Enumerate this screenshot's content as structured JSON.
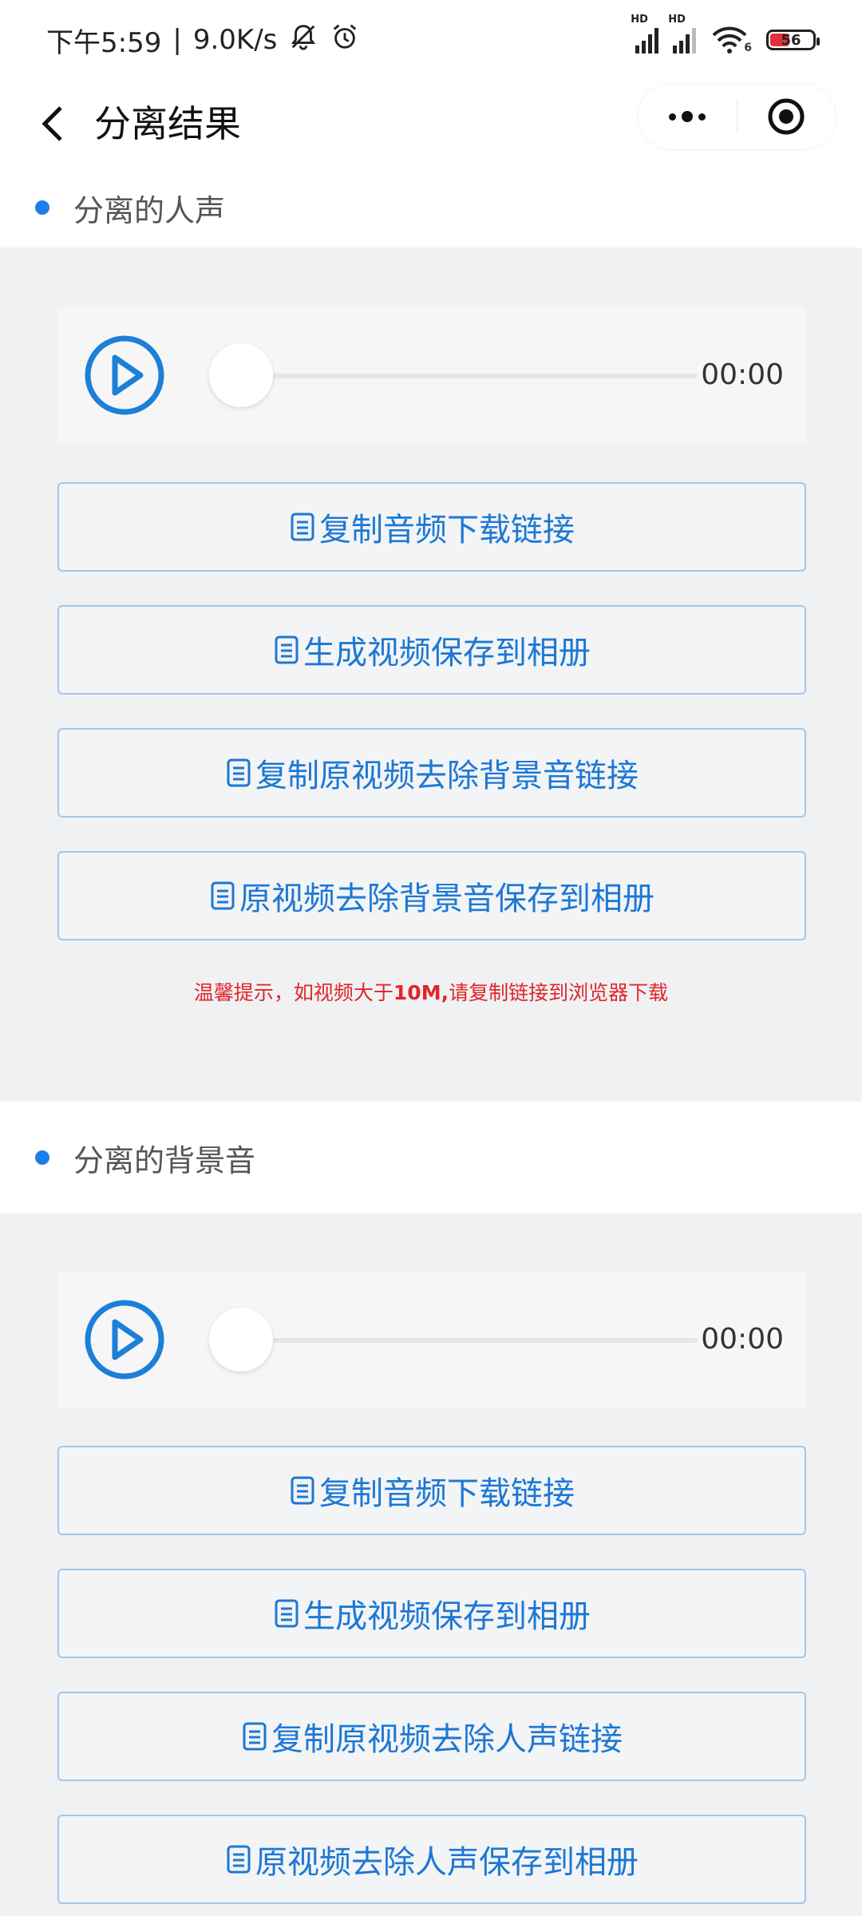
{
  "status_bar": {
    "time": "下午5:59",
    "separator": "|",
    "net_speed": "9.0K/s",
    "signal1_label": "HD",
    "signal2_label": "HD",
    "wifi_label": "6",
    "battery_level": "56"
  },
  "nav": {
    "title": "分离结果"
  },
  "sections": [
    {
      "title": "分离的人声",
      "player_time": "00:00",
      "buttons": [
        "复制音频下载链接",
        "生成视频保存到相册",
        "复制原视频去除背景音链接",
        "原视频去除背景音保存到相册"
      ],
      "tip": {
        "before": "温馨提示，如视频大于",
        "bold": "10M,",
        "after": "请复制链接到浏览器下载"
      }
    },
    {
      "title": "分离的背景音",
      "player_time": "00:00",
      "buttons": [
        "复制音频下载链接",
        "生成视频保存到相册",
        "复制原视频去除人声链接",
        "原视频去除人声保存到相册"
      ]
    }
  ],
  "colors": {
    "accent": "#1e7ee8",
    "button_text": "#1c78d4",
    "button_border": "#9ec8ee",
    "tip": "#e0262b",
    "page_bg": "#f0f1f3"
  },
  "icons": {
    "back": "chevron-left-icon",
    "more": "more-dots-icon",
    "close": "target-circle-icon",
    "play": "play-circle-icon",
    "button": "document-icon"
  }
}
